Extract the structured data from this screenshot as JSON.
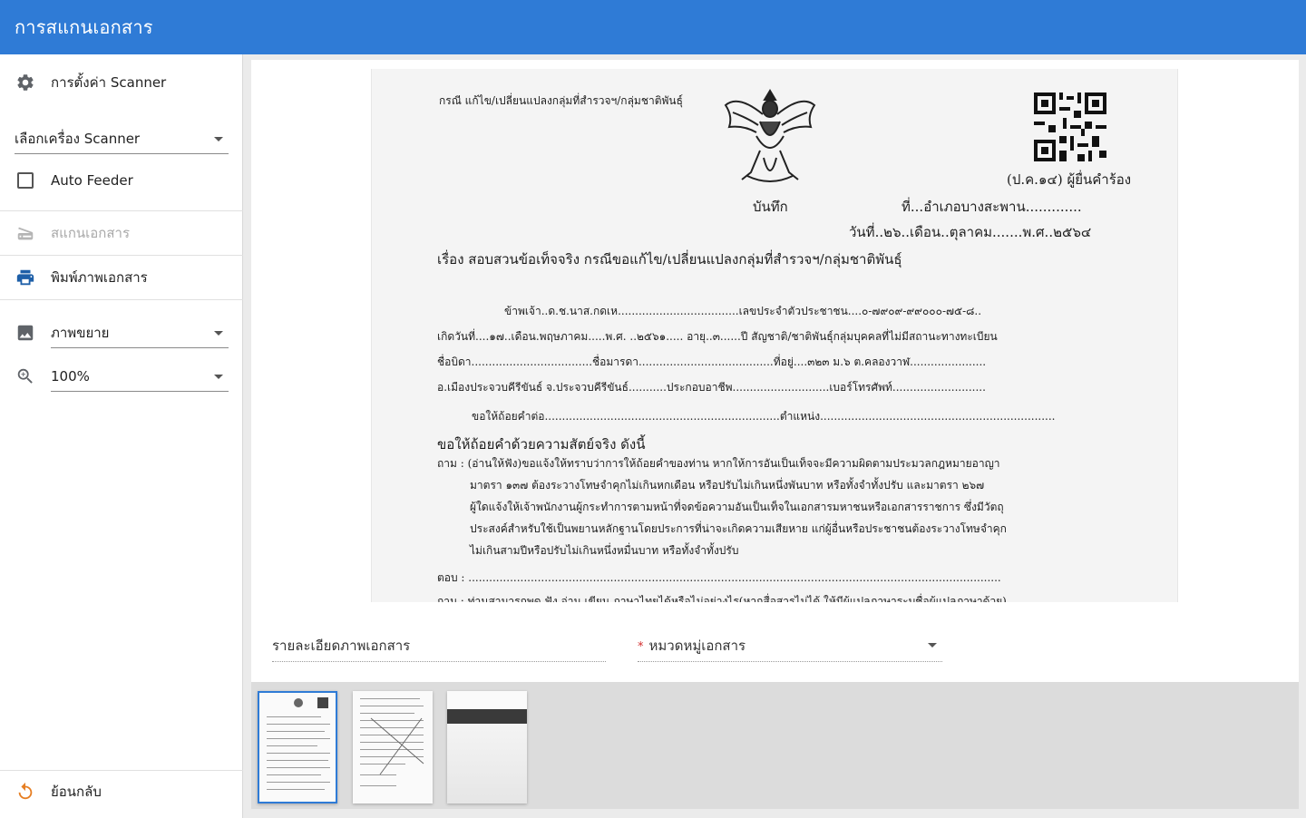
{
  "app": {
    "title": "การสแกนเอกสาร"
  },
  "sidebar": {
    "settings_label": "การตั้งค่า Scanner",
    "scanner_select": {
      "value": "เลือกเครื่อง Scanner"
    },
    "auto_feeder_label": "Auto Feeder",
    "auto_feeder_checked": false,
    "scan_label": "สแกนเอกสาร",
    "print_label": "พิมพ์ภาพเอกสาร",
    "image_mode_select": {
      "value": "ภาพขยาย"
    },
    "zoom_select": {
      "value": "100%"
    },
    "back_label": "ย้อนกลับ"
  },
  "document": {
    "header_note": "กรณี แก้ไข/เปลี่ยนแปลงกลุ่มที่สำรวจฯ/กลุ่มชาติพันธุ์",
    "form_code": "(ป.ค.๑๔) ผู้ยื่นคำร้อง",
    "memo": "บันทึก",
    "place": "ที่...อำเภอบางสะพาน.............",
    "date": "วันที่..๒๖..เดือน..ตุลาคม.......พ.ศ..๒๕๖๔",
    "subject": "เรื่อง  สอบสวนข้อเท็จจริง กรณีขอแก้ไข/เปลี่ยนแปลงกลุ่มที่สำรวจฯ/กลุ่มชาติพันธุ์",
    "lines": [
      "ข้าพเจ้า..ด.ช.นาส.กดเห...................................เลขประจำตัวประชาชน....๐-๗๙๐๙-๙๙๐๐๐-๗๕-๘..",
      "เกิดวันที่....๑๗..เดือน.พฤษภาคม.....พ.ศ. ..๒๕๖๑..... อายุ..๓......ปี สัญชาติ/ชาติพันธุ์กลุ่มบุคคลที่ไม่มีสถานะทางทะเบียน",
      "ชื่อบิดา...................................ชื่อมารดา.......................................ที่อยู่....๓๒๓ ม.๖ ต.คลองวาฬ......................",
      "อ.เมืองประจวบคีรีขันธ์ จ.ประจวบคีรีขันธ์...........ประกอบอาชีพ............................เบอร์โทรศัพท์...........................",
      "ขอให้ถ้อยคำต่อ....................................................................ตำแหน่ง....................................................................",
      "ขอให้ถ้อยคำด้วยความสัตย์จริง ดังนี้",
      "ถาม : (อ่านให้ฟัง)ขอแจ้งให้ทราบว่าการให้ถ้อยคำของท่าน หากให้การอันเป็นเท็จจะมีความผิดตามประมวลกฎหมายอาญา",
      "มาตรา ๑๓๗ ต้องระวางโทษจำคุกไม่เกินหกเดือน  หรือปรับไม่เกินหนึ่งพันบาท  หรือทั้งจำทั้งปรับ  และมาตรา ๒๖๗",
      "ผู้ใดแจ้งให้เจ้าพนักงานผู้กระทำการตามหน้าที่จดข้อความอันเป็นเท็จในเอกสารมหาชนหรือเอกสารราชการ ซึ่งมีวัตถุ",
      "ประสงค์สำหรับใช้เป็นพยานหลักฐานโดยประการที่น่าจะเกิดความเสียหาย แก่ผู้อื่นหรือประชาชนต้องระวางโทษจำคุก",
      "ไม่เกินสามปีหรือปรับไม่เกินหนึ่งหมื่นบาท หรือทั้งจำทั้งปรับ",
      "ตอบ :  ..........................................................................................................................................................",
      "ถาม : ท่านสามารถพูด ฟัง อ่าน เขียน ภาษาไทยได้หรือไม่อย่างไร(หากสื่อสารไม่ได้ ให้มีผู้แปลภาษาระบุชื่อผู้แปลภาษาด้วย)"
    ]
  },
  "details": {
    "description_label": "รายละเอียดภาพเอกสาร",
    "category_label": "หมวดหมู่เอกสาร",
    "category_required_mark": "*"
  },
  "thumbnails": {
    "count": 3,
    "selected_index": 0
  },
  "colors": {
    "appbar": "#2f7bd6",
    "icon": "#5f6368",
    "print_icon": "#1e5fa8",
    "back_icon": "#e67e22"
  }
}
